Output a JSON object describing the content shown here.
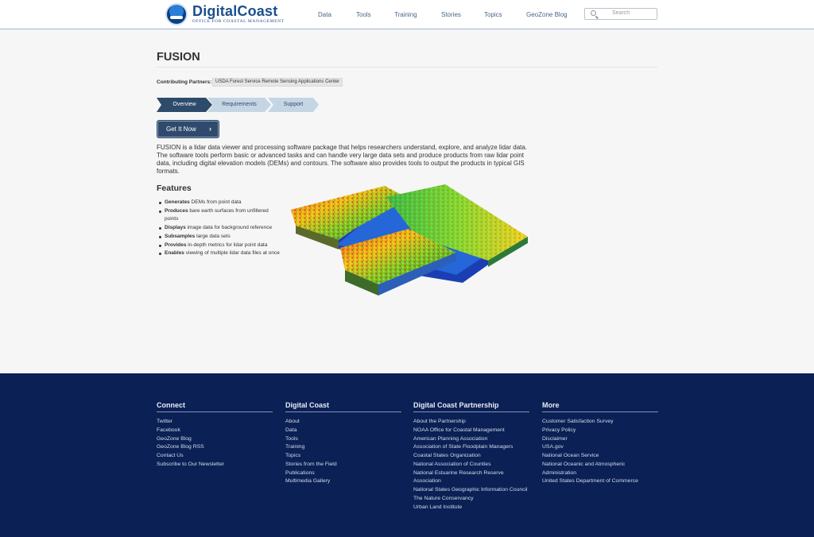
{
  "header": {
    "logo_title": "DigitalCoast",
    "logo_subtitle": "OFFICE FOR COASTAL MANAGEMENT",
    "nav": [
      "Data",
      "Tools",
      "Training",
      "Stories",
      "Topics",
      "GeoZone Blog"
    ],
    "search_placeholder": "Search"
  },
  "main": {
    "title": "FUSION",
    "partners_label": "Contributing Partners:",
    "partner": "USDA Forest Service Remote Sensing Applications Center",
    "tabs": [
      "Overview",
      "Requirements",
      "Support"
    ],
    "active_tab": "Overview",
    "cta_label": "Get It Now",
    "description": "FUSION is a lidar data viewer and processing software package that helps researchers understand, explore, and analyze lidar data. The software tools perform basic or advanced tasks and can handle very large data sets and produce products from raw lidar point data, including digital elevation models (DEMs) and contours. The software also provides tools to output the products in typical GIS formats.",
    "features_title": "Features",
    "features": [
      {
        "bold": "Generates",
        "text": " DEMs from point data"
      },
      {
        "bold": "Produces",
        "text": " bare earth surfaces from unfiltered points"
      },
      {
        "bold": "Displays",
        "text": " image data for background reference"
      },
      {
        "bold": "Subsamples",
        "text": " large data sets"
      },
      {
        "bold": "Provides",
        "text": " in-depth metrics for lidar point data"
      },
      {
        "bold": "Enables",
        "text": " viewing of multiple lidar data files at once"
      }
    ]
  },
  "footer": {
    "columns": [
      {
        "title": "Connect",
        "links": [
          "Twitter",
          "Facebook",
          "GeoZone Blog",
          "GeoZone Blog RSS",
          "Contact Us",
          "Subscribe to Our Newsletter"
        ]
      },
      {
        "title": "Digital Coast",
        "links": [
          "About",
          "Data",
          "Tools",
          "Training",
          "Topics",
          "Stories from the Field",
          "Publications",
          "Multimedia Gallery"
        ]
      },
      {
        "title": "Digital Coast Partnership",
        "links": [
          "About the Partnership",
          "NOAA Office for Coastal Management",
          "American Planning Association",
          "Association of State Floodplain Managers",
          "Coastal States Organization",
          "National Association of Counties",
          "National Estuarine Research Reserve Association",
          "National States Geographic Information Council",
          "The Nature Conservancy",
          "Urban Land Institute"
        ]
      },
      {
        "title": "More",
        "links": [
          "Customer Satisfaction Survey",
          "Privacy Policy",
          "Disclaimer",
          "USA.gov",
          "National Ocean Service",
          "National Oceanic and Atmospheric Administration",
          "United States Department of Commerce"
        ]
      }
    ]
  },
  "colors": {
    "header_rule": "#9fb2cc",
    "tab_active": "#2e4b6c",
    "tab_inactive": "#c4d5e3",
    "footer_bg": "#0b2055"
  }
}
